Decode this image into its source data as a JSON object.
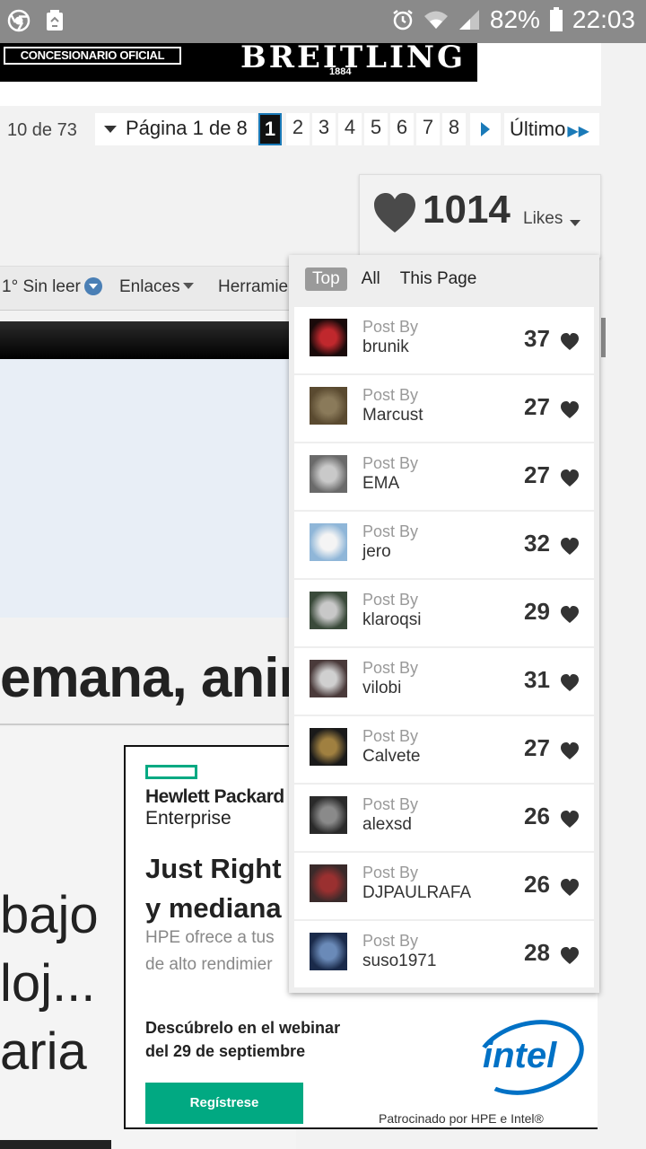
{
  "status_bar": {
    "battery": "82%",
    "time": "22:03",
    "icons": [
      "chrome-icon",
      "recycle-icon",
      "alarm-icon",
      "wifi-icon",
      "signal-icon",
      "battery-icon"
    ]
  },
  "ad_top": {
    "tag": "CONCESIONARIO OFICIAL",
    "brand": "BREITLING",
    "year": "1884"
  },
  "pagination": {
    "count": "10 de 73",
    "page_label": "Página 1 de 8",
    "pages": [
      "1",
      "2",
      "3",
      "4",
      "5",
      "6",
      "7",
      "8"
    ],
    "active_page": "1",
    "last_label": "Último"
  },
  "toolbar": {
    "unread": "1° Sin leer",
    "links": "Enlaces",
    "tools": "Herramie"
  },
  "article": {
    "title_fragment": "emana, anir",
    "body_lines": [
      "bajo",
      "loj...",
      "aria"
    ]
  },
  "hpe_ad": {
    "brand_line1": "Hewlett Packard",
    "brand_line2": "Enterprise",
    "headline_line1": "Just Right",
    "headline_line2": "y mediana",
    "sub_line1": "HPE ofrece a tus",
    "sub_line2": "de alto rendimier",
    "cta_line1": "Descúbrelo en el webinar",
    "cta_line2": "del 29 de septiembre",
    "button": "Regístrese",
    "intel": "intel",
    "sponsor": "Patrocinado por HPE e Intel®"
  },
  "likes": {
    "count": "1014",
    "word": "Likes",
    "tabs": [
      "Top",
      "All",
      "This Page"
    ],
    "active_tab": "Top",
    "post_by_label": "Post By",
    "rows": [
      {
        "user": "brunik",
        "count": "37"
      },
      {
        "user": "Marcust",
        "count": "27"
      },
      {
        "user": "EMA",
        "count": "27"
      },
      {
        "user": "jero",
        "count": "32"
      },
      {
        "user": "klaroqsi",
        "count": "29"
      },
      {
        "user": "vilobi",
        "count": "31"
      },
      {
        "user": "Calvete",
        "count": "27"
      },
      {
        "user": "alexsd",
        "count": "26"
      },
      {
        "user": "DJPAULRAFA",
        "count": "26"
      },
      {
        "user": "suso1971",
        "count": "28"
      }
    ]
  },
  "colors": {
    "status_bar": "#8a8a8a",
    "accent_blue": "#1a7ab8",
    "hpe_green": "#01a982",
    "intel_blue": "#0071c5",
    "heart": "#333333"
  }
}
